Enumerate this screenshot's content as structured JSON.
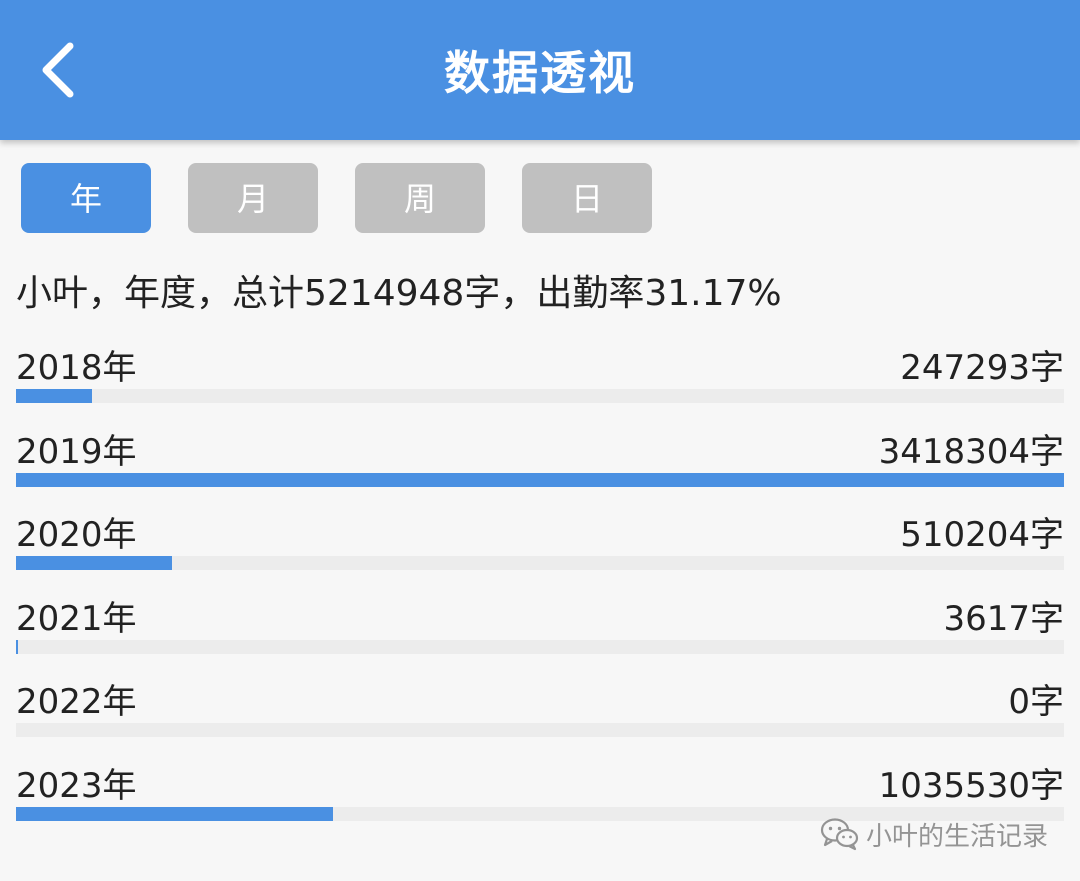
{
  "header": {
    "title": "数据透视",
    "back_icon": "chevron-left-icon",
    "color": "#4a90e2"
  },
  "tabs": [
    {
      "label": "年",
      "active": true
    },
    {
      "label": "月",
      "active": false
    },
    {
      "label": "周",
      "active": false
    },
    {
      "label": "日",
      "active": false
    }
  ],
  "summary": {
    "text": "小叶，年度，总计5214948字，出勤率31.17%"
  },
  "rows": [
    {
      "label": "2018年",
      "value_text": "247293字",
      "value": 247293
    },
    {
      "label": "2019年",
      "value_text": "3418304字",
      "value": 3418304
    },
    {
      "label": "2020年",
      "value_text": "510204字",
      "value": 510204
    },
    {
      "label": "2021年",
      "value_text": "3617字",
      "value": 3617
    },
    {
      "label": "2022年",
      "value_text": "0字",
      "value": 0
    },
    {
      "label": "2023年",
      "value_text": "1035530字",
      "value": 1035530
    }
  ],
  "max_value": 3418304,
  "watermark": {
    "icon": "wechat-icon",
    "text": "小叶的生活记录"
  },
  "colors": {
    "accent": "#4a90e2",
    "inactive_tab": "#c0c0c0",
    "track": "#ececec"
  }
}
